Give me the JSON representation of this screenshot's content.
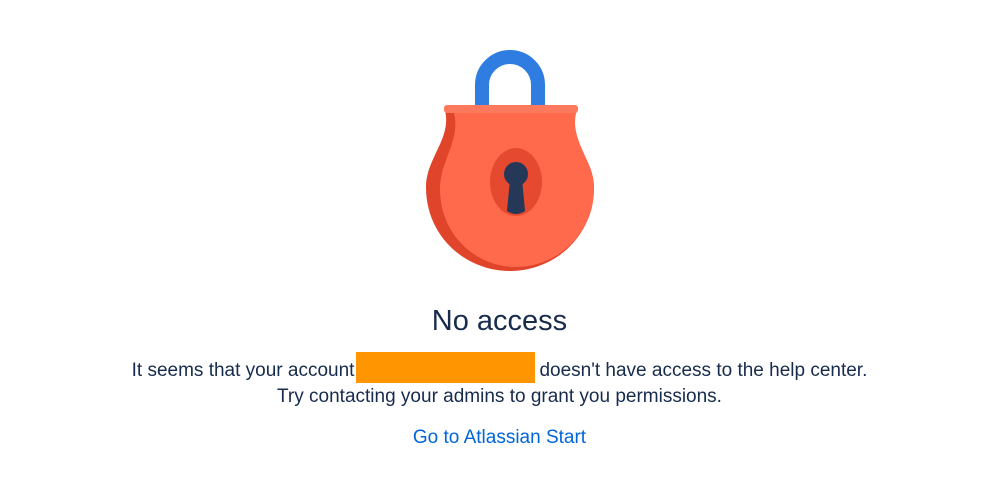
{
  "illustration": {
    "icon": "padlock-icon",
    "colors": {
      "shackle": "#2f7de1",
      "body": "#ff6a4d",
      "body_shadow": "#e0442a",
      "keyhole": "#253858"
    }
  },
  "heading": "No access",
  "message": {
    "line1_before": "It seems that your account",
    "line1_after": "doesn't have access to the help center.",
    "line2": "Try contacting your admins to grant you permissions.",
    "redaction_color": "#ff9500"
  },
  "link": {
    "label": "Go to Atlassian Start",
    "color": "#0065d9"
  }
}
